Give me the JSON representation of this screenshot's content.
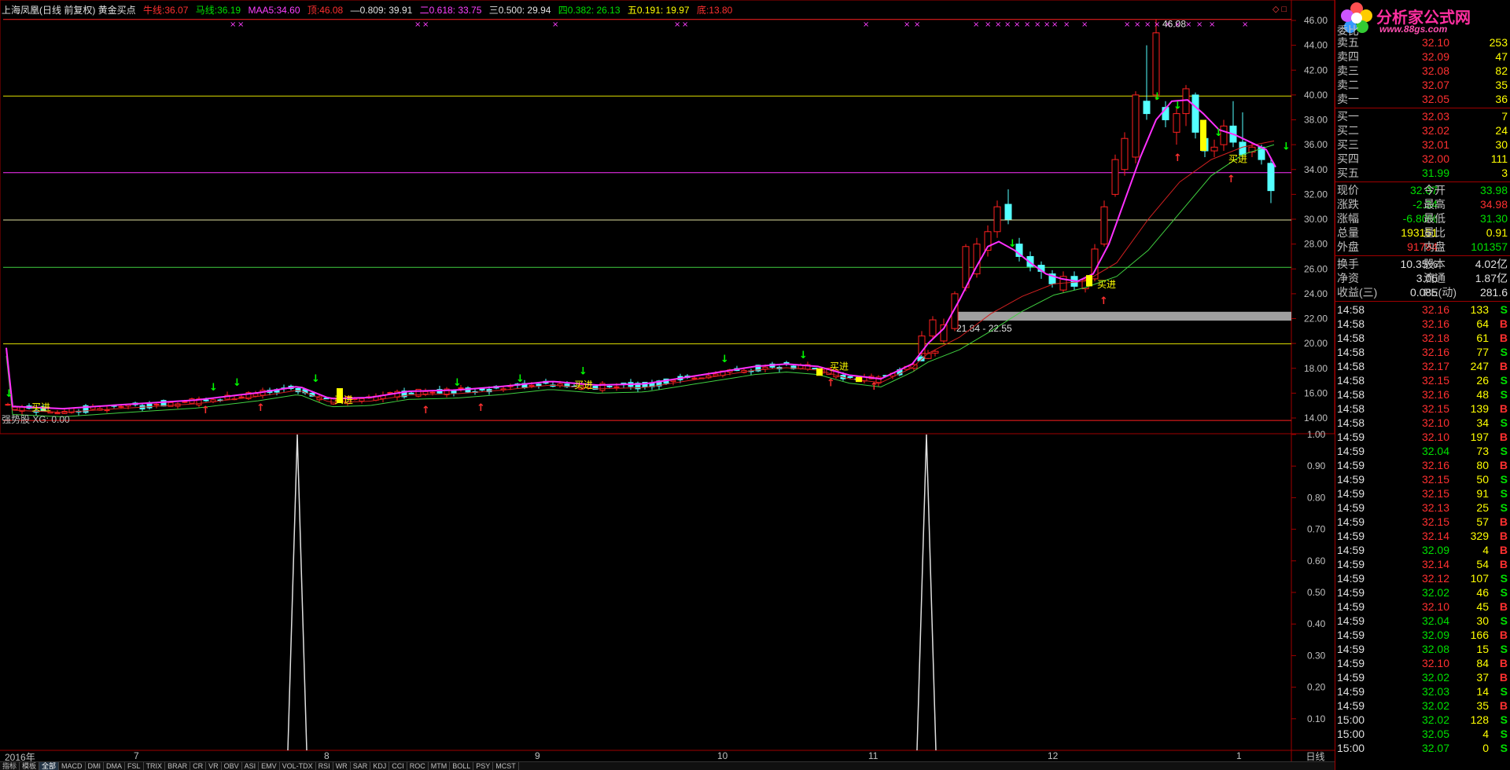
{
  "title_bar": {
    "stock": "上海凤凰(日线 前复权) 黄金买点",
    "niuxian_label": "牛线:",
    "niuxian_value": "36.07",
    "maxian_label": "马线:",
    "maxian_value": "36.19",
    "maa5_label": "MAA5:",
    "maa5_value": "34.60",
    "ding_label": "顶:",
    "ding_value": "46.08",
    "f809": "—0.809: 39.91",
    "f618": "二0.618: 33.75",
    "f500": "三0.500: 29.94",
    "f382": "四0.382: 26.13",
    "f191": "五0.191: 19.97",
    "di_label": "底:",
    "di_value": "13.80"
  },
  "price_axis": [
    "46.00",
    "44.00",
    "42.00",
    "40.00",
    "38.00",
    "36.00",
    "34.00",
    "32.00",
    "30.00",
    "28.00",
    "26.00",
    "24.00",
    "22.00",
    "20.00",
    "18.00",
    "16.00",
    "14.00"
  ],
  "indicator_axis": [
    "1.00",
    "0.90",
    "0.80",
    "0.70",
    "0.60",
    "0.50",
    "0.40",
    "0.30",
    "0.20",
    "0.10"
  ],
  "peak_label": "46.08",
  "range_label": "21.84 - 22.55",
  "buy_label": "买进",
  "indicator_label": "强势股 XG: 0.00",
  "month_axis": [
    "2016年",
    "7",
    "8",
    "9",
    "10",
    "11",
    "12",
    "1"
  ],
  "period_button": "日线",
  "corner_buttons": "◇ □",
  "tabs": [
    "指标",
    "模板",
    "全部",
    "MACD",
    "DMI",
    "DMA",
    "FSL",
    "TRIX",
    "BRAR",
    "CR",
    "VR",
    "OBV",
    "ASI",
    "EMV",
    "VOL-TDX",
    "RSI",
    "WR",
    "SAR",
    "KDJ",
    "CCI",
    "ROC",
    "MTM",
    "BOLL",
    "PSY",
    "MCST"
  ],
  "active_tab": "全部",
  "logo": {
    "brand": "分析家公式网",
    "url": "www.88gs.com"
  },
  "order_book": {
    "header": "委比",
    "sell": [
      {
        "label": "卖五",
        "price": "32.10",
        "vol": "253"
      },
      {
        "label": "卖四",
        "price": "32.09",
        "vol": "47"
      },
      {
        "label": "卖三",
        "price": "32.08",
        "vol": "82"
      },
      {
        "label": "卖二",
        "price": "32.07",
        "vol": "35"
      },
      {
        "label": "卖一",
        "price": "32.05",
        "vol": "36"
      }
    ],
    "buy": [
      {
        "label": "买一",
        "price": "32.03",
        "vol": "7"
      },
      {
        "label": "买二",
        "price": "32.02",
        "vol": "24"
      },
      {
        "label": "买三",
        "price": "32.01",
        "vol": "30"
      },
      {
        "label": "买四",
        "price": "32.00",
        "vol": "111"
      },
      {
        "label": "买五",
        "price": "31.99",
        "vol": "3"
      }
    ]
  },
  "stats": [
    {
      "l1": "现价",
      "v1": "32.07",
      "c1": "green",
      "l2": "今开",
      "v2": "33.98",
      "c2": "green"
    },
    {
      "l1": "涨跌",
      "v1": "-2.34",
      "c1": "green",
      "l2": "最高",
      "v2": "34.98",
      "c2": "red"
    },
    {
      "l1": "涨幅",
      "v1": "-6.80%",
      "c1": "green",
      "l2": "最低",
      "v2": "31.30",
      "c2": "green"
    },
    {
      "l1": "总量",
      "v1": "193151",
      "c1": "yellow",
      "l2": "量比",
      "v2": "0.91",
      "c2": "yellow"
    },
    {
      "l1": "外盘",
      "v1": "91794",
      "c1": "red",
      "l2": "内盘",
      "v2": "101357",
      "c2": "green"
    }
  ],
  "stats2": [
    {
      "l1": "换手",
      "v1": "10.35%",
      "c1": "white",
      "l2": "股本",
      "v2": "4.02亿",
      "c2": "white"
    },
    {
      "l1": "净资",
      "v1": "3.06",
      "c1": "white",
      "l2": "流通",
      "v2": "1.87亿",
      "c2": "white"
    },
    {
      "l1": "收益(三)",
      "v1": "0.085",
      "c1": "white",
      "l2": "PE(动)",
      "v2": "281.6",
      "c2": "white"
    }
  ],
  "ticks": [
    {
      "t": "14:58",
      "p": "32.16",
      "pc": "red",
      "v": "133",
      "d": "S"
    },
    {
      "t": "14:58",
      "p": "32.16",
      "pc": "red",
      "v": "64",
      "d": "B"
    },
    {
      "t": "14:58",
      "p": "32.18",
      "pc": "red",
      "v": "61",
      "d": "B"
    },
    {
      "t": "14:58",
      "p": "32.16",
      "pc": "red",
      "v": "77",
      "d": "S"
    },
    {
      "t": "14:58",
      "p": "32.17",
      "pc": "red",
      "v": "247",
      "d": "B"
    },
    {
      "t": "14:58",
      "p": "32.15",
      "pc": "red",
      "v": "26",
      "d": "S"
    },
    {
      "t": "14:58",
      "p": "32.16",
      "pc": "red",
      "v": "48",
      "d": "S"
    },
    {
      "t": "14:58",
      "p": "32.15",
      "pc": "red",
      "v": "139",
      "d": "B"
    },
    {
      "t": "14:58",
      "p": "32.10",
      "pc": "red",
      "v": "34",
      "d": "S"
    },
    {
      "t": "14:59",
      "p": "32.10",
      "pc": "red",
      "v": "197",
      "d": "B"
    },
    {
      "t": "14:59",
      "p": "32.04",
      "pc": "green",
      "v": "73",
      "d": "S"
    },
    {
      "t": "14:59",
      "p": "32.16",
      "pc": "red",
      "v": "80",
      "d": "B"
    },
    {
      "t": "14:59",
      "p": "32.15",
      "pc": "red",
      "v": "50",
      "d": "S"
    },
    {
      "t": "14:59",
      "p": "32.15",
      "pc": "red",
      "v": "91",
      "d": "S"
    },
    {
      "t": "14:59",
      "p": "32.13",
      "pc": "red",
      "v": "25",
      "d": "S"
    },
    {
      "t": "14:59",
      "p": "32.15",
      "pc": "red",
      "v": "57",
      "d": "B"
    },
    {
      "t": "14:59",
      "p": "32.14",
      "pc": "red",
      "v": "329",
      "d": "B"
    },
    {
      "t": "14:59",
      "p": "32.09",
      "pc": "green",
      "v": "4",
      "d": "B"
    },
    {
      "t": "14:59",
      "p": "32.14",
      "pc": "red",
      "v": "54",
      "d": "B"
    },
    {
      "t": "14:59",
      "p": "32.12",
      "pc": "red",
      "v": "107",
      "d": "S"
    },
    {
      "t": "14:59",
      "p": "32.02",
      "pc": "green",
      "v": "46",
      "d": "S"
    },
    {
      "t": "14:59",
      "p": "32.10",
      "pc": "red",
      "v": "45",
      "d": "B"
    },
    {
      "t": "14:59",
      "p": "32.04",
      "pc": "green",
      "v": "30",
      "d": "S"
    },
    {
      "t": "14:59",
      "p": "32.09",
      "pc": "green",
      "v": "166",
      "d": "B"
    },
    {
      "t": "14:59",
      "p": "32.08",
      "pc": "green",
      "v": "15",
      "d": "S"
    },
    {
      "t": "14:59",
      "p": "32.10",
      "pc": "red",
      "v": "84",
      "d": "B"
    },
    {
      "t": "14:59",
      "p": "32.02",
      "pc": "green",
      "v": "37",
      "d": "B"
    },
    {
      "t": "14:59",
      "p": "32.03",
      "pc": "green",
      "v": "14",
      "d": "S"
    },
    {
      "t": "14:59",
      "p": "32.02",
      "pc": "green",
      "v": "35",
      "d": "B"
    },
    {
      "t": "15:00",
      "p": "32.02",
      "pc": "green",
      "v": "128",
      "d": "S"
    },
    {
      "t": "15:00",
      "p": "32.05",
      "pc": "green",
      "v": "4",
      "d": "S"
    },
    {
      "t": "15:00",
      "p": "32.07",
      "pc": "green",
      "v": "0",
      "d": "S"
    }
  ],
  "colors": {
    "up": "#ff2020",
    "down": "#54ffff",
    "ma_main": "#ff30ff",
    "ma_red": "#d02020",
    "ma_green": "#40d040",
    "bg": "#000000",
    "frame": "#a00000"
  }
}
